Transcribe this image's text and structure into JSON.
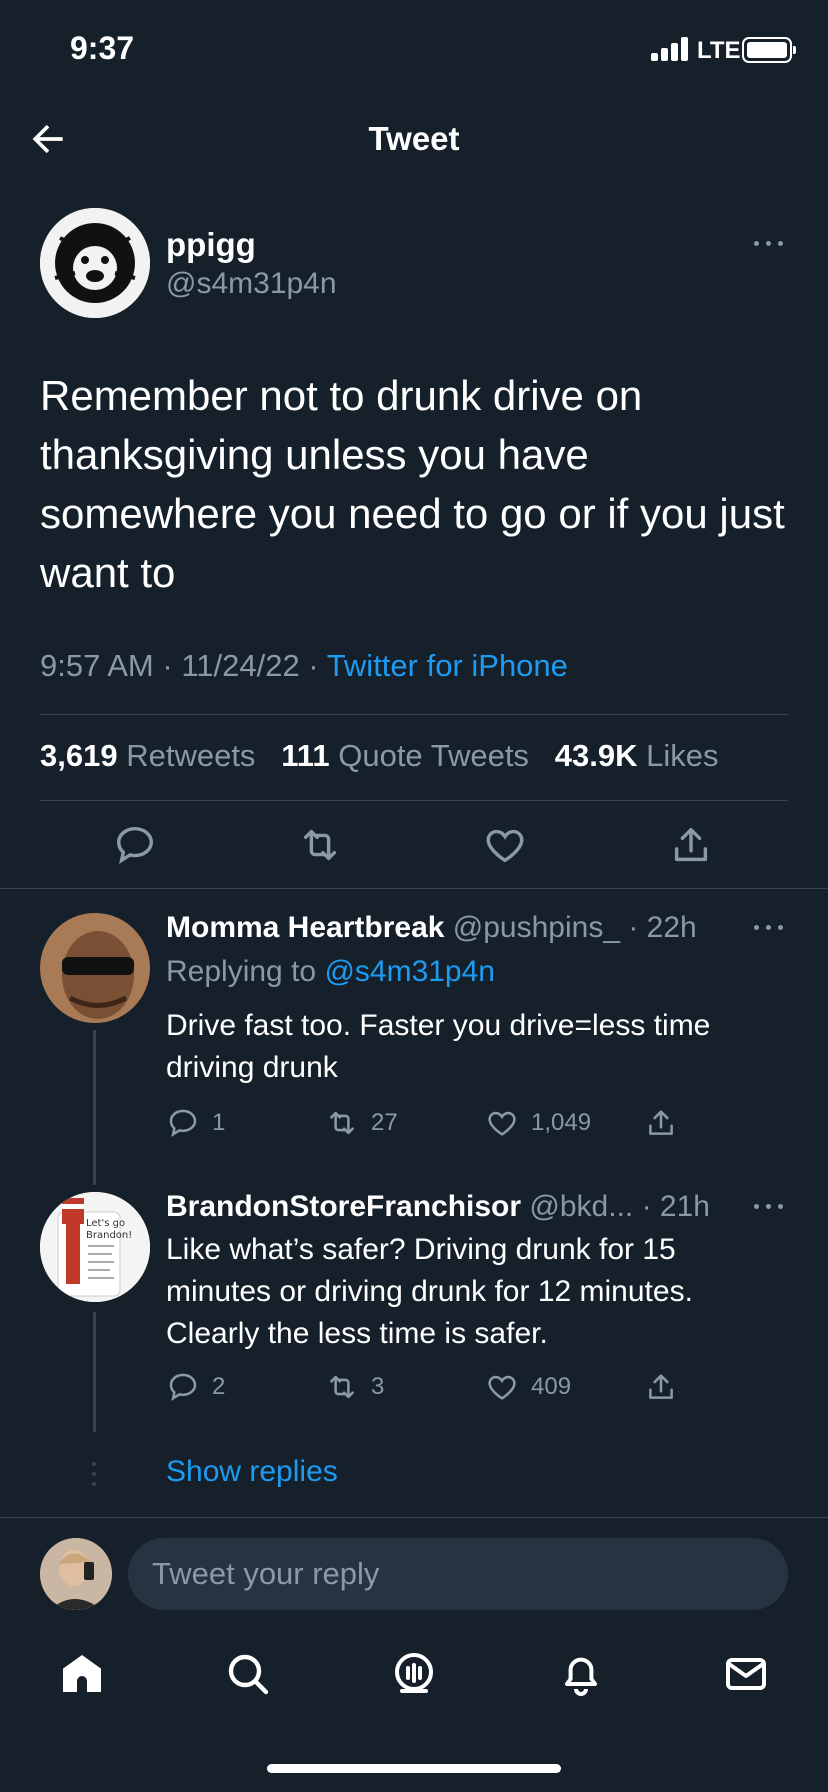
{
  "status_bar": {
    "time": "9:37",
    "network": "LTE"
  },
  "header": {
    "title": "Tweet"
  },
  "tweet": {
    "author_name": "ppigg",
    "author_handle": "@s4m31p4n",
    "text": "Remember not to drunk drive on thanksgiving unless you have somewhere you need to go or if you just want to",
    "time": "9:57 AM",
    "date": "11/24/22",
    "source": "Twitter for iPhone",
    "stats": {
      "retweets_count": "3,619",
      "retweets_label": "Retweets",
      "quotes_count": "111",
      "quotes_label": "Quote Tweets",
      "likes_count": "43.9K",
      "likes_label": "Likes"
    }
  },
  "replies": [
    {
      "name": "Momma Heartbreak",
      "header_rest": "@pushpins_ · 22h",
      "replying_prefix": "Replying to",
      "replying_handle": "@s4m31p4n",
      "text": "Drive fast too. Faster you drive=less time driving drunk",
      "reply_count": "1",
      "retweet_count": "27",
      "like_count": "1,049"
    },
    {
      "name": "BrandonStoreFranchisor",
      "header_rest": "@bkd... · 21h",
      "text": "Like what’s safer?  Driving drunk for 15 minutes or driving drunk for 12 minutes. Clearly the less time is safer.",
      "reply_count": "2",
      "retweet_count": "3",
      "like_count": "409",
      "avatar_text": [
        "Let's go",
        "Brandon!"
      ]
    }
  ],
  "show_replies": "Show replies",
  "reply_bar": {
    "placeholder": "Tweet your reply"
  },
  "tab_bar": [
    "home-icon",
    "search-icon",
    "spaces-icon",
    "notifications-icon",
    "messages-icon"
  ],
  "colors": {
    "background": "#15202b",
    "accent": "#1d9bf0",
    "muted": "#8b98a5",
    "divider": "#38444d"
  }
}
